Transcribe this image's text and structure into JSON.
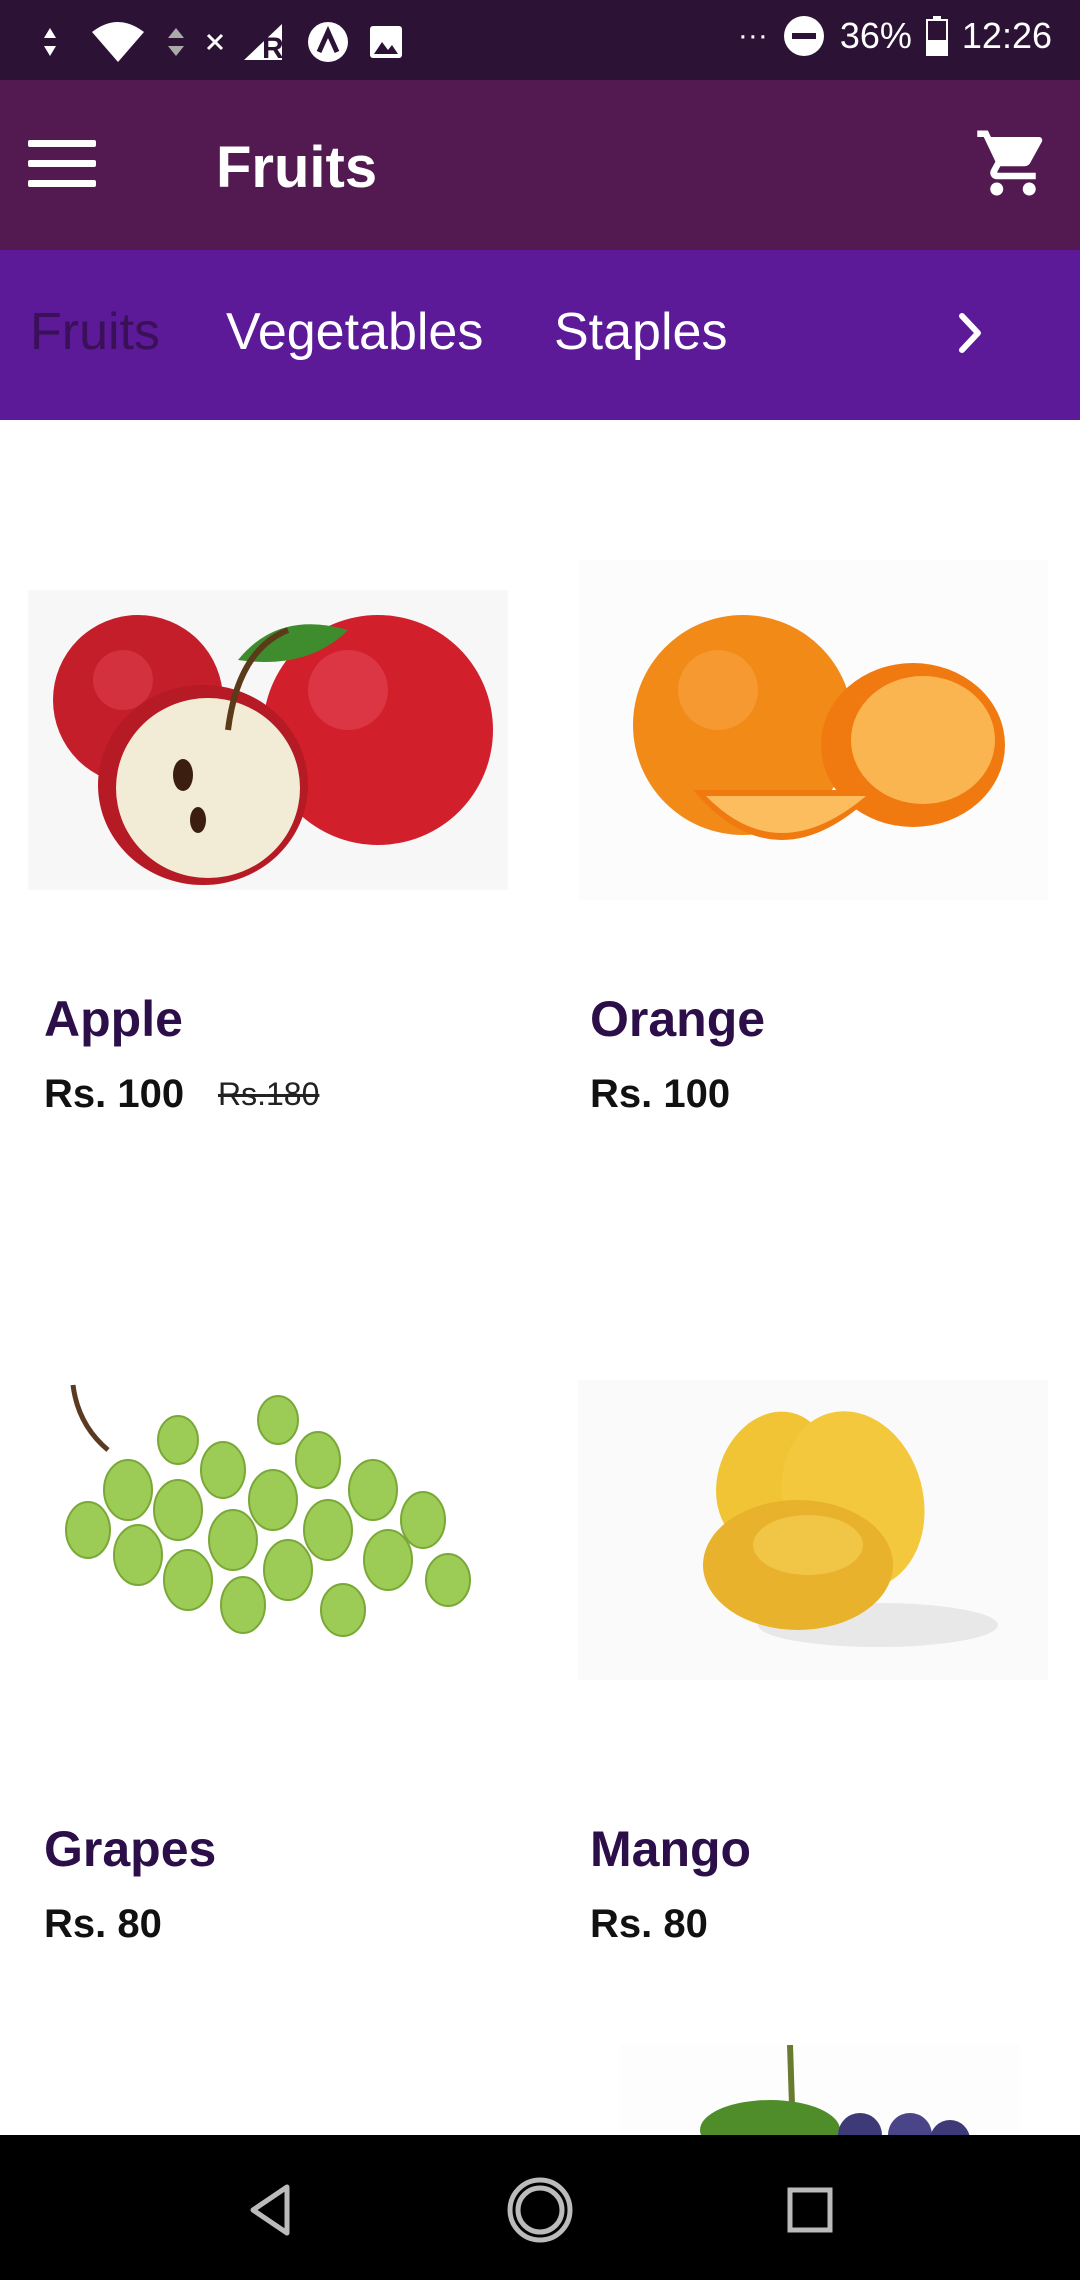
{
  "status_bar": {
    "battery": "36%",
    "time": "12:26",
    "overflow_dots": "···"
  },
  "app_bar": {
    "title": "Fruits",
    "menu_icon": "hamburger-menu-icon",
    "cart_icon": "shopping-cart-icon"
  },
  "tabs": [
    {
      "label": "Fruits",
      "active": true
    },
    {
      "label": "Vegetables",
      "active": false
    },
    {
      "label": "Staples",
      "active": false
    }
  ],
  "products": [
    {
      "name": "Apple",
      "price": "Rs. 100",
      "old_price": "Rs.180"
    },
    {
      "name": "Orange",
      "price": "Rs. 100",
      "old_price": ""
    },
    {
      "name": "Grapes",
      "price": "Rs. 80",
      "old_price": ""
    },
    {
      "name": "Mango",
      "price": "Rs. 80",
      "old_price": ""
    }
  ],
  "colors": {
    "status_bar": "#2c1235",
    "app_bar": "#521a50",
    "tab_bar": "#5c1a98",
    "active_tab": "#3a1058",
    "product_name": "#2c0f48"
  }
}
